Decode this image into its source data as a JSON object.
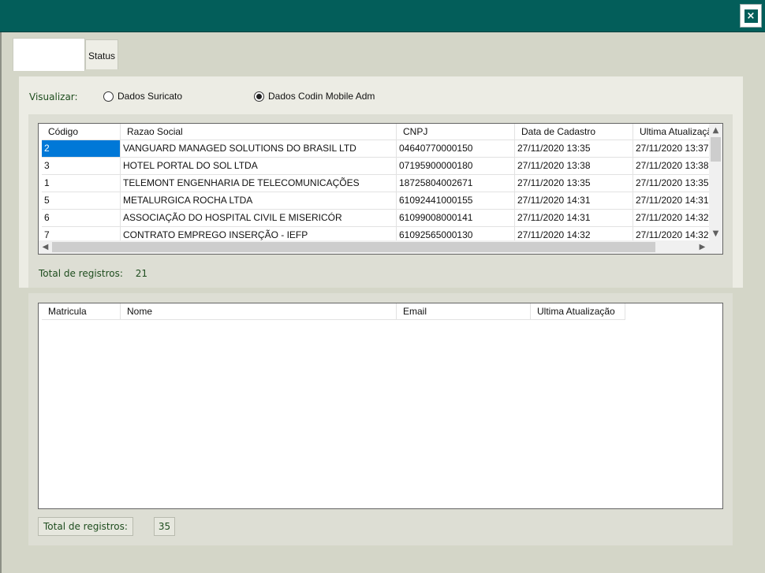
{
  "window": {
    "close_label": "×"
  },
  "tabs": [
    {
      "label": ""
    },
    {
      "label": "Status"
    }
  ],
  "view": {
    "label": "Visualizar:",
    "options": [
      {
        "label": "Dados Suricato",
        "selected": false
      },
      {
        "label": "Dados Codin Mobile Adm",
        "selected": true
      }
    ]
  },
  "companies": {
    "columns": [
      "Código",
      "Razao Social",
      "CNPJ",
      "Data de Cadastro",
      "Ultima Atualização"
    ],
    "rows": [
      [
        "2",
        "VANGUARD MANAGED SOLUTIONS DO BRASIL LTD",
        "04640770000150",
        "27/11/2020 13:35",
        "27/11/2020 13:37"
      ],
      [
        "3",
        "HOTEL PORTAL DO SOL LTDA",
        "07195900000180",
        "27/11/2020 13:38",
        "27/11/2020 13:38"
      ],
      [
        "1",
        "TELEMONT ENGENHARIA DE TELECOMUNICAÇÕES",
        "18725804002671",
        "27/11/2020 13:35",
        "27/11/2020 13:35"
      ],
      [
        "5",
        "METALURGICA ROCHA LTDA",
        "61092441000155",
        "27/11/2020 14:31",
        "27/11/2020 14:31"
      ],
      [
        "6",
        "ASSOCIAÇÃO DO HOSPITAL CIVIL E MISERICÓR",
        "61099008000141",
        "27/11/2020 14:31",
        "27/11/2020 14:32"
      ],
      [
        "7",
        "CONTRATO EMPREGO INSERÇÃO - IEFP",
        "61092565000130",
        "27/11/2020 14:32",
        "27/11/2020 14:32"
      ]
    ],
    "total_label": "Total de registros:",
    "total_value": "21"
  },
  "employees": {
    "columns": [
      "Matricula",
      "Nome",
      "Email",
      "Ultima Atualização"
    ],
    "total_label": "Total de registros:",
    "total_value": "35"
  },
  "icons": {
    "close": "close-icon",
    "radio": "radio-icon",
    "scroll_up": "chevron-up-icon",
    "scroll_down": "chevron-down-icon",
    "scroll_left": "chevron-left-icon",
    "scroll_right": "chevron-right-icon"
  },
  "colors": {
    "titlebar": "#035e5a",
    "label_green": "#1e4d1e",
    "selection": "#0078d7"
  }
}
